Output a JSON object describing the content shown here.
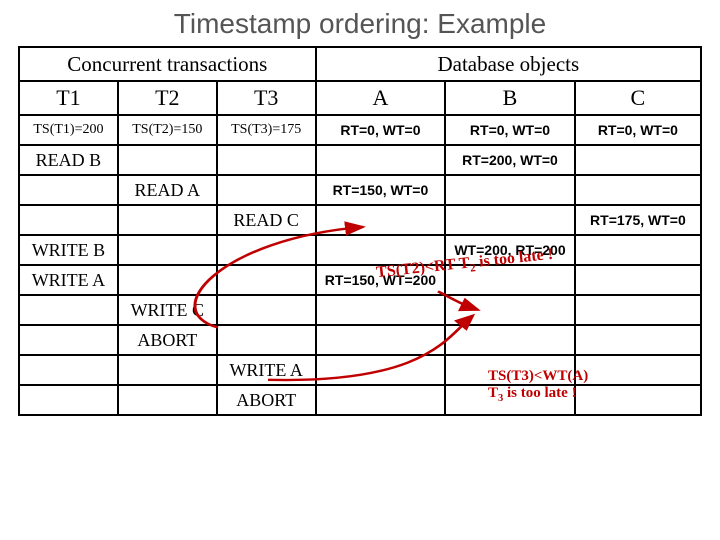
{
  "title": "Timestamp ordering: Example",
  "group_left": "Concurrent transactions",
  "group_right": "Database objects",
  "cols": {
    "t1": "T1",
    "t2": "T2",
    "t3": "T3",
    "a": "A",
    "b": "B",
    "c": "C"
  },
  "ts": {
    "t1": "TS(T1)=200",
    "t2": "TS(T2)=150",
    "t3": "TS(T3)=175",
    "a": "RT=0, WT=0",
    "b": "RT=0, WT=0",
    "c": "RT=0, WT=0"
  },
  "rows": {
    "r3": {
      "t1": "READ B",
      "b": "RT=200, WT=0"
    },
    "r4": {
      "t2": "READ A",
      "a": "RT=150, WT=0"
    },
    "r5": {
      "t3": "READ C",
      "c": "RT=175, WT=0"
    },
    "r6": {
      "t1": "WRITE B",
      "b": "WT=200, RT=200"
    },
    "r7": {
      "t1": "WRITE A",
      "a": "RT=150, WT=200"
    },
    "r8": {
      "t2": "WRITE C"
    },
    "r9": {
      "t2": "ABORT"
    },
    "r10": {
      "t3": "WRITE A"
    },
    "r11": {
      "t3": "ABORT"
    }
  },
  "ann1_a": "TS(T2)<RT T",
  "ann1_b": "2",
  "ann1_c": " is too late !",
  "ann2_a": "TS(T3)<WT(A)",
  "ann2_b": "T",
  "ann2_c": "3",
  "ann2_d": " is too late !"
}
